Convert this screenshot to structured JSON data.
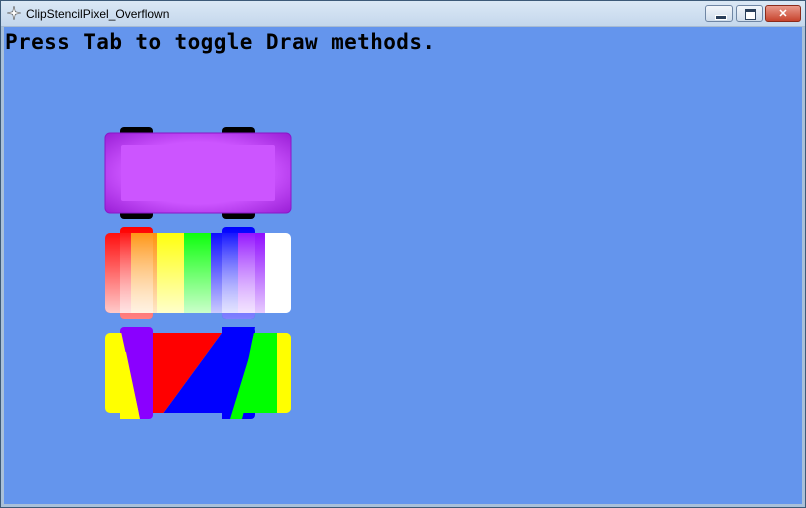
{
  "window": {
    "title": "ClipStencilPixel_Overflown",
    "app_icon": "sparkle-icon",
    "controls": {
      "minimize": "minimize-icon",
      "maximize": "maximize-icon",
      "close": "close-icon"
    }
  },
  "canvas": {
    "background": "#6495ED",
    "instruction": "Press Tab to toggle Draw methods."
  },
  "sprites": {
    "car_body": "#CC55FF",
    "wheels": "#000000",
    "rainbow_stripes": [
      "#FF0000",
      "#FF8C00",
      "#FFFF00",
      "#00FF00",
      "#0000FF",
      "#8A00FF",
      "#FFFFFF"
    ],
    "bottom_colors": [
      "#FFFF00",
      "#8A00FF",
      "#FF0000",
      "#0000FF",
      "#00FF00",
      "#FFFF00"
    ]
  }
}
